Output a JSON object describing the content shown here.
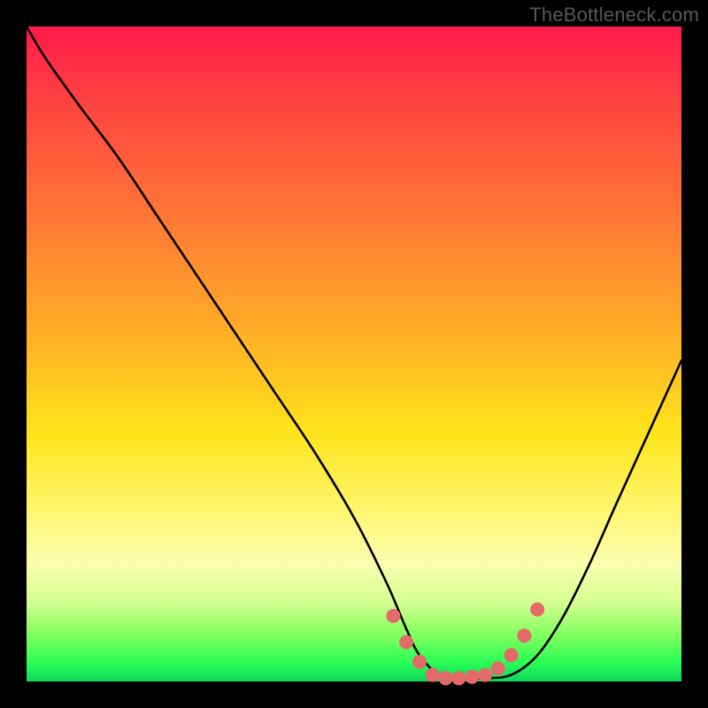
{
  "attribution": "TheBottleneck.com",
  "colors": {
    "page_bg": "#000000",
    "gradient_top": "#ff1a4b",
    "gradient_mid": "#ffe41a",
    "gradient_bottom": "#10d65d",
    "curve": "#000000",
    "marker": "#e46a6a"
  },
  "chart_data": {
    "type": "line",
    "title": "",
    "xlabel": "",
    "ylabel": "",
    "xlim": [
      0,
      100
    ],
    "ylim": [
      0,
      100
    ],
    "series": [
      {
        "name": "bottleneck-curve",
        "x": [
          0,
          3,
          8,
          14,
          20,
          26,
          32,
          38,
          44,
          50,
          55,
          58,
          60,
          63,
          66,
          70,
          74,
          78,
          82,
          86,
          90,
          95,
          100
        ],
        "y": [
          100,
          95,
          88,
          80,
          71,
          62,
          53,
          44,
          35,
          25,
          15,
          8,
          4,
          1,
          0.5,
          0.5,
          1,
          4,
          10,
          18,
          27,
          38,
          49
        ]
      }
    ],
    "markers": {
      "name": "highlight-dots",
      "x": [
        56,
        58,
        60,
        62,
        64,
        66,
        68,
        70,
        72,
        74,
        76,
        78
      ],
      "y": [
        10,
        6,
        3,
        1,
        0.5,
        0.5,
        0.7,
        1,
        2,
        4,
        7,
        11
      ]
    }
  }
}
